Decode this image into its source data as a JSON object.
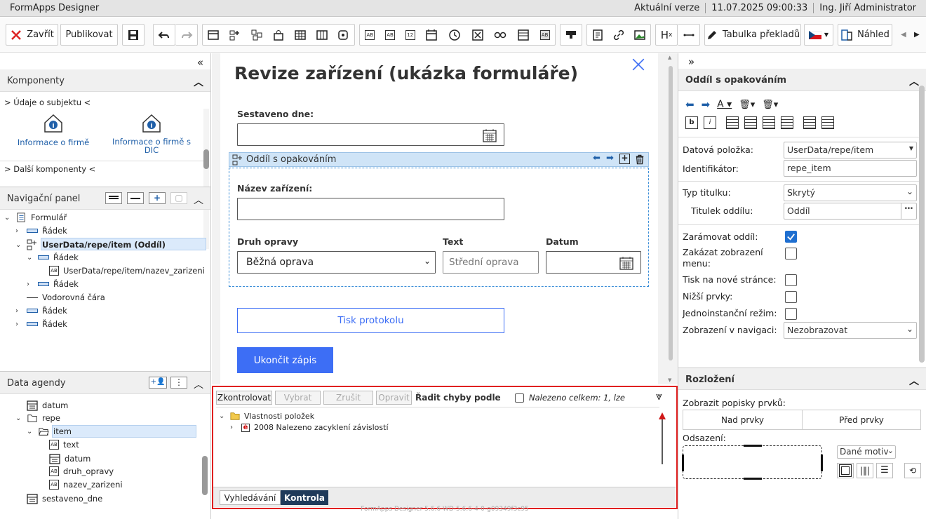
{
  "titlebar": {
    "app": "FormApps Designer",
    "version": "Aktuální verze",
    "datetime": "11.07.2025 09:00:33",
    "user": "Ing. Jiří Administrator"
  },
  "toolbar": {
    "close_label": "Zavřít",
    "publish_label": "Publikovat",
    "translations_label": "Tabulka překladů",
    "preview_label": "Náhled",
    "heading_label": "H",
    "heading_sub": "x"
  },
  "left": {
    "components_title": "Komponenty",
    "group1": "> Údaje o subjektu <",
    "comp1": "Informace o firmě",
    "comp2": "Informace o firmě s DIC",
    "group2": "> Další komponenty <",
    "nav_title": "Navigační panel",
    "nav_items": [
      "Formulář",
      "Řádek",
      "UserData/repe/item (Oddíl)",
      "Řádek",
      "UserData/repe/item/nazev_zarizeni",
      "Řádek",
      "Vodorovná čára",
      "Řádek",
      "Řádek"
    ],
    "agenda_title": "Data agendy",
    "agenda_items": [
      "datum",
      "repe",
      "item",
      "text",
      "datum",
      "druh_opravy",
      "nazev_zarizeni",
      "sestaveno_dne"
    ]
  },
  "form": {
    "title": "Revize zařízení (ukázka formuláře)",
    "sestaveno_label": "Sestaveno dne:",
    "section_label": "Oddíl s opakováním",
    "nazev_label": "Název zařízení:",
    "druh_label": "Druh opravy",
    "druh_value": "Běžná oprava",
    "text_label": "Text",
    "text_placeholder": "Střední oprava",
    "datum_label": "Datum",
    "print_button": "Tisk protokolu",
    "finish_button": "Ukončit zápis"
  },
  "checker": {
    "check_btn": "Zkontrolovat",
    "select_btn": "Vybrat",
    "cancel_btn": "Zrušit",
    "fix_btn": "Opravit",
    "sort_label": "Řadit chyby podle",
    "found_label": "Nalezeno celkem: 1, lze",
    "node1": "Vlastnosti položek",
    "node2": "2008 Nalezeno zacyklení závislostí",
    "tab_search": "Vyhledávání",
    "tab_check": "Kontrola",
    "footer": "FormApps Designer 5.6.6-WD-5.6.6-4-0-g09349f3c95"
  },
  "right": {
    "section_title": "Oddíl s opakováním",
    "datova_label": "Datová položka:",
    "datova_value": "UserData/repe/item",
    "ident_label": "Identifikátor:",
    "ident_value": "repe_item",
    "typ_label": "Typ titulku:",
    "typ_value": "Skrytý",
    "titulek_label": "Titulek oddílu:",
    "titulek_value": "Oddíl",
    "zaramovat_label": "Zarámovat oddíl:",
    "zakazat_label": "Zakázat zobrazení menu:",
    "tisk_label": "Tisk na nové stránce:",
    "nizsi_label": "Nižší prvky:",
    "jedno_label": "Jednoinstanční režim:",
    "zobr_label": "Zobrazení v navigaci:",
    "zobr_value": "Nezobrazovat",
    "layout_title": "Rozložení",
    "popisky_label": "Zobrazit popisky prvků:",
    "nad_label": "Nad prvky",
    "pred_label": "Před prvky",
    "odsazeni_label": "Odsazení:",
    "motiv_value": "Dané motiv"
  },
  "colors": {
    "accent": "#3d6ef5",
    "highlight": "#e02020",
    "section": "#cfe4f7"
  }
}
